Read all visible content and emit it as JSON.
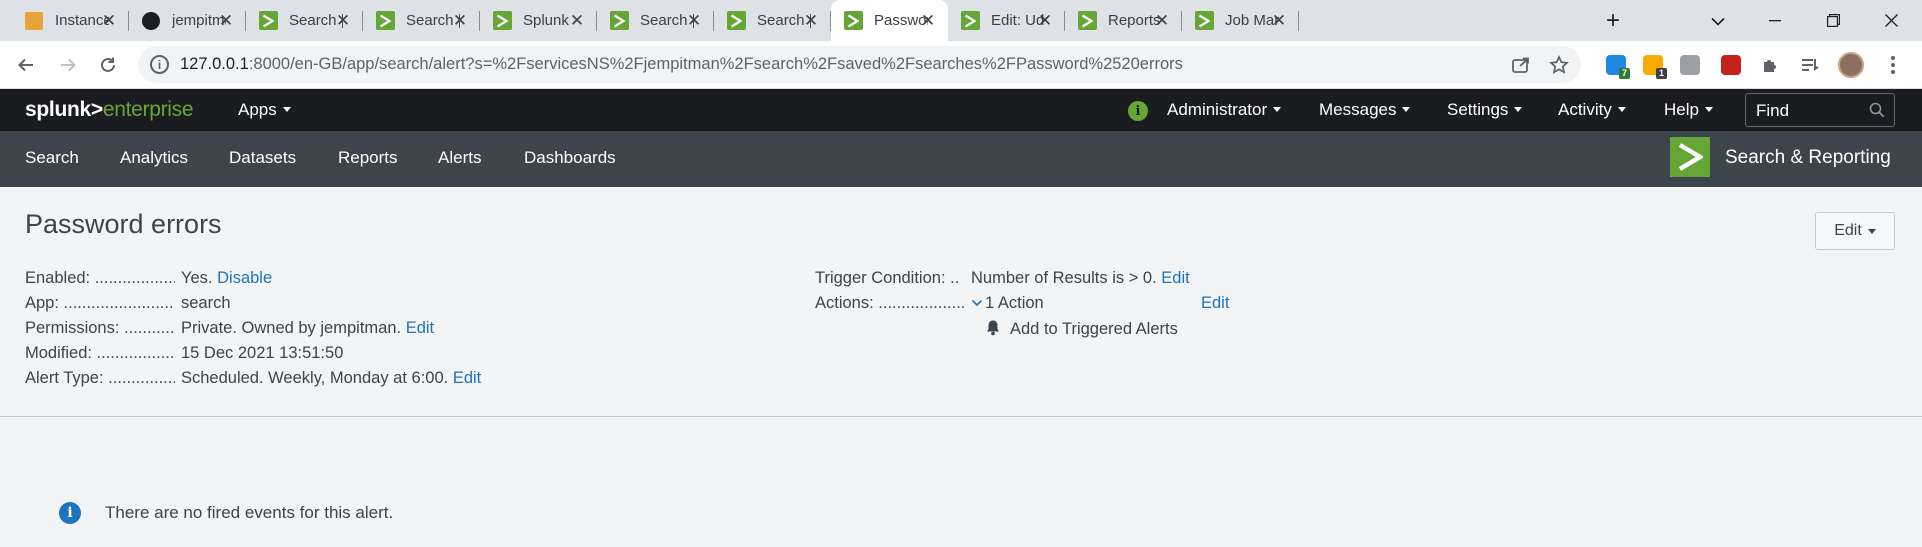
{
  "browser": {
    "tabs": [
      {
        "title": "Instance c",
        "icon": "package-icon"
      },
      {
        "title": "jempitma",
        "icon": "github-icon"
      },
      {
        "title": "Search | S",
        "icon": "splunk-icon"
      },
      {
        "title": "Search | S",
        "icon": "splunk-icon"
      },
      {
        "title": "Splunk",
        "icon": "splunk-icon"
      },
      {
        "title": "Search | S",
        "icon": "splunk-icon"
      },
      {
        "title": "Search | S",
        "icon": "splunk-icon"
      },
      {
        "title": "Password",
        "icon": "splunk-icon",
        "active": true
      },
      {
        "title": "Edit: Uda",
        "icon": "splunk-icon"
      },
      {
        "title": "Reports |",
        "icon": "splunk-icon"
      },
      {
        "title": "Job Mana",
        "icon": "splunk-icon"
      }
    ],
    "url_host": "127.0.0.1",
    "url_rest": ":8000/en-GB/app/search/alert?s=%2FservicesNS%2Fjempitman%2Fsearch%2Fsaved%2Fsearches%2FPassword%2520errors",
    "extensions": [
      {
        "name": "clockify-extension-icon",
        "badge": "7",
        "color": "#1e88e5",
        "badge_color": "#2e7d32"
      },
      {
        "name": "notes-extension-icon",
        "badge": "1",
        "color": "#f9ab00",
        "badge_color": "#3c4043"
      },
      {
        "name": "chat-extension-icon",
        "badge": "",
        "color": "#9aa0a6"
      },
      {
        "name": "pdf-extension-icon",
        "badge": "",
        "color": "#c5221f"
      }
    ]
  },
  "splunk": {
    "logo_main": "splunk>",
    "logo_sub": "enterprise",
    "menu": {
      "apps": "Apps",
      "administrator": "Administrator",
      "messages": "Messages",
      "settings": "Settings",
      "activity": "Activity",
      "help": "Help"
    },
    "find_placeholder": "Find",
    "nav": [
      "Search",
      "Analytics",
      "Datasets",
      "Reports",
      "Alerts",
      "Dashboards"
    ],
    "app_name": "Search & Reporting",
    "accent": "#65a637"
  },
  "alert": {
    "title": "Password errors",
    "edit_label": "Edit",
    "left": [
      {
        "label": "Enabled: ..........................",
        "value": "Yes.",
        "link": "Disable"
      },
      {
        "label": "App: ....................................",
        "value": "search",
        "link": ""
      },
      {
        "label": "Permissions: ..................",
        "value": "Private. Owned by jempitman.",
        "link": "Edit"
      },
      {
        "label": "Modified: ........................",
        "value": "15 Dec 2021 13:51:50",
        "link": ""
      },
      {
        "label": "Alert Type: .....................",
        "value": "Scheduled. Weekly, Monday at 6:00.",
        "link": "Edit"
      }
    ],
    "trigger_label": "Trigger Condition: ..",
    "trigger_value": "Number of Results is > 0.",
    "trigger_link": "Edit",
    "actions_label": "Actions: ..........................",
    "actions_value": "1 Action",
    "actions_link": "Edit",
    "action_item": "Add to Triggered Alerts"
  },
  "events": {
    "empty_message": "There are no fired events for this alert."
  }
}
